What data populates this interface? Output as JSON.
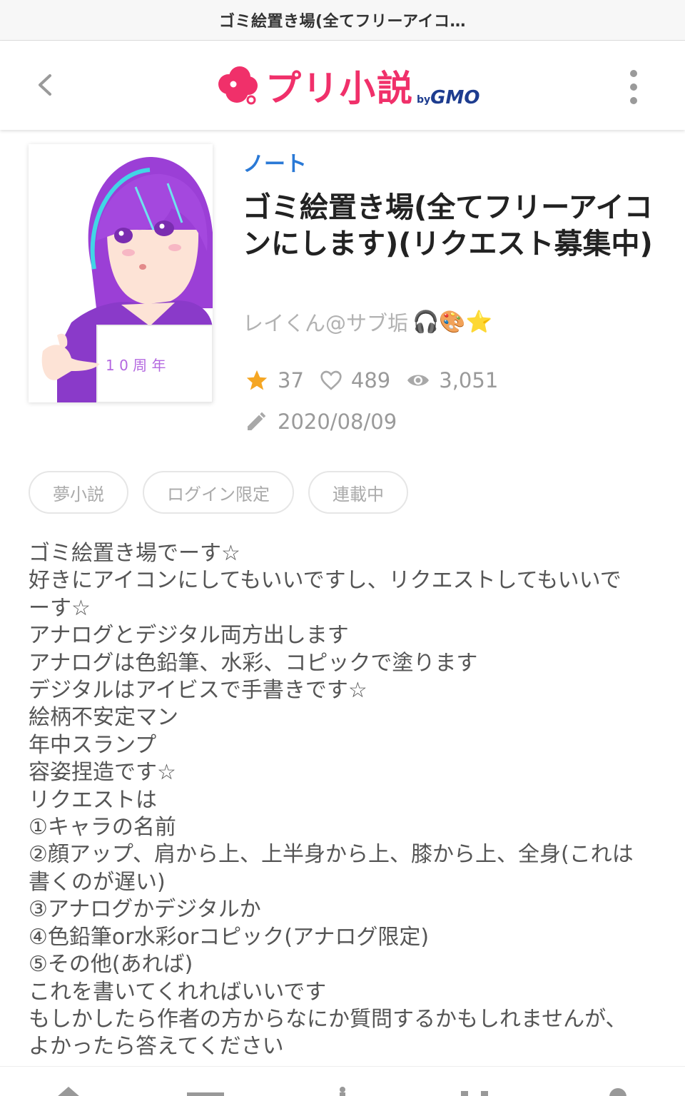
{
  "tab": {
    "title": "ゴミ絵置き場(全てフリーアイコ…"
  },
  "header": {
    "logo_text": "プリ小説",
    "logo_by": "by",
    "logo_gmo": "GMO"
  },
  "work": {
    "category": "ノート",
    "title": "ゴミ絵置き場(全てフリーアイコンにします)(リクエスト募集中)",
    "author": "レイくん@サブ垢",
    "author_emoji": "🎧🎨⭐",
    "cover_text": "1 0 周 年",
    "stars": "37",
    "likes": "489",
    "views": "3,051",
    "date": "2020/08/09"
  },
  "tags": [
    "夢小説",
    "ログイン限定",
    "連載中"
  ],
  "description": [
    "ゴミ絵置き場でーす☆",
    "好きにアイコンにしてもいいですし、リクエストしてもいいで",
    "ーす☆",
    "アナログとデジタル両方出します",
    "アナログは色鉛筆、水彩、コピックで塗ります",
    "デジタルはアイビスで手書きです☆",
    "絵柄不安定マン",
    "年中スランプ",
    "容姿捏造です☆",
    "リクエストは",
    "①キャラの名前",
    "②顔アップ、肩から上、上半身から上、膝から上、全身(これは",
    "書くのが遅い)",
    "③アナログかデジタルか",
    "④色鉛筆or水彩orコピック(アナログ限定)",
    "⑤その他(あれば)",
    "これを書いてくれればいいです",
    "もしかしたら作者の方からなにか質問するかもしれませんが、",
    "よかったら答えてください"
  ],
  "colors": {
    "brand": "#f0306a",
    "gmo": "#1d3c8f",
    "category": "#2a79d6",
    "star": "#f5a623"
  },
  "icons": {
    "back": "chevron-left-icon",
    "menu": "kebab-menu-icon",
    "star": "star-icon",
    "heart": "heart-icon",
    "eye": "eye-icon",
    "pencil": "pencil-icon"
  }
}
